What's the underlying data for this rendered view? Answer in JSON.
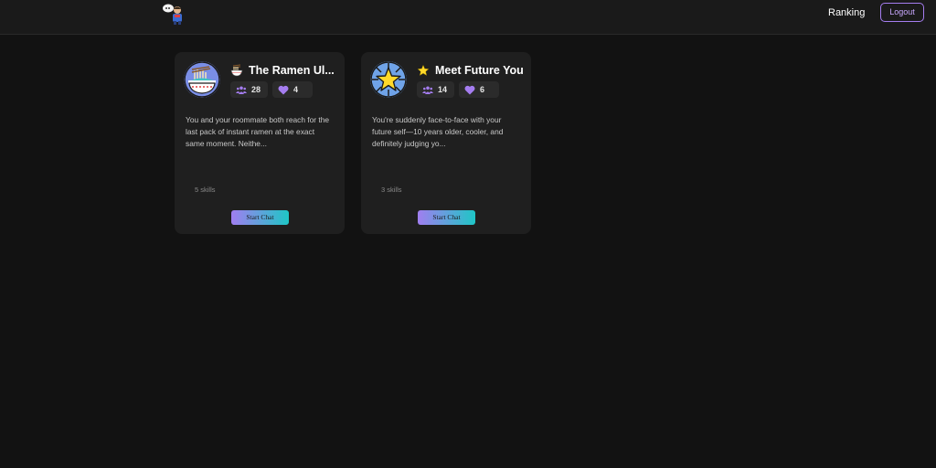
{
  "nav": {
    "ranking_label": "Ranking",
    "logout_label": "Logout",
    "accent": "#a57df0"
  },
  "cards": [
    {
      "avatar_icon": "ramen-bowl-icon",
      "title_icon": "ramen-emoji-icon",
      "title": "The Ramen Ul...",
      "users": "28",
      "likes": "4",
      "description": "You and your roommate both reach for the last pack of instant ramen at the exact same moment. Neithe...",
      "skills": "5 skills",
      "button_label": "Start Chat"
    },
    {
      "avatar_icon": "star-icon",
      "title_icon": "star-emoji-icon",
      "title": "Meet Future You",
      "users": "14",
      "likes": "6",
      "description": "You're suddenly face-to-face with your future self—10 years older, cooler, and definitely judging yo...",
      "skills": "3 skills",
      "button_label": "Start Chat"
    }
  ]
}
